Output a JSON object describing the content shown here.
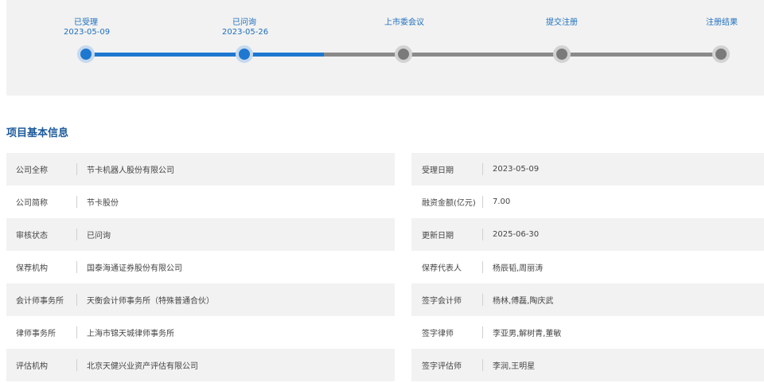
{
  "progress": {
    "steps": [
      {
        "label": "已受理",
        "date": "2023-05-09",
        "state": "done"
      },
      {
        "label": "已问询",
        "date": "2023-05-26",
        "state": "done"
      },
      {
        "label": "上市委会议",
        "date": "",
        "state": "todo"
      },
      {
        "label": "提交注册",
        "date": "",
        "state": "todo"
      },
      {
        "label": "注册结果",
        "date": "",
        "state": "todo"
      }
    ],
    "completed_fraction": 0.375,
    "colors": {
      "done": "#1e78d0",
      "todo": "#7a7a7a",
      "label": "#1e6fbd"
    }
  },
  "section": {
    "title": "项目基本信息"
  },
  "info": {
    "left": [
      {
        "label": "公司全称",
        "value": "节卡机器人股份有限公司"
      },
      {
        "label": "公司简称",
        "value": "节卡股份"
      },
      {
        "label": "审核状态",
        "value": "已问询"
      },
      {
        "label": "保荐机构",
        "value": "国泰海通证券股份有限公司"
      },
      {
        "label": "会计师事务所",
        "value": "天衡会计师事务所（特殊普通合伙）"
      },
      {
        "label": "律师事务所",
        "value": "上海市锦天城律师事务所"
      },
      {
        "label": "评估机构",
        "value": "北京天健兴业资产评估有限公司"
      }
    ],
    "right": [
      {
        "label": "受理日期",
        "value": "2023-05-09"
      },
      {
        "label": "融资金额(亿元)",
        "value": "7.00"
      },
      {
        "label": "更新日期",
        "value": "2025-06-30"
      },
      {
        "label": "保荐代表人",
        "value": "杨辰韬,周丽涛"
      },
      {
        "label": "签字会计师",
        "value": "杨林,傅磊,陶庆武"
      },
      {
        "label": "签字律师",
        "value": "李亚男,解树青,董敏"
      },
      {
        "label": "签字评估师",
        "value": "李润,王明星"
      }
    ]
  }
}
